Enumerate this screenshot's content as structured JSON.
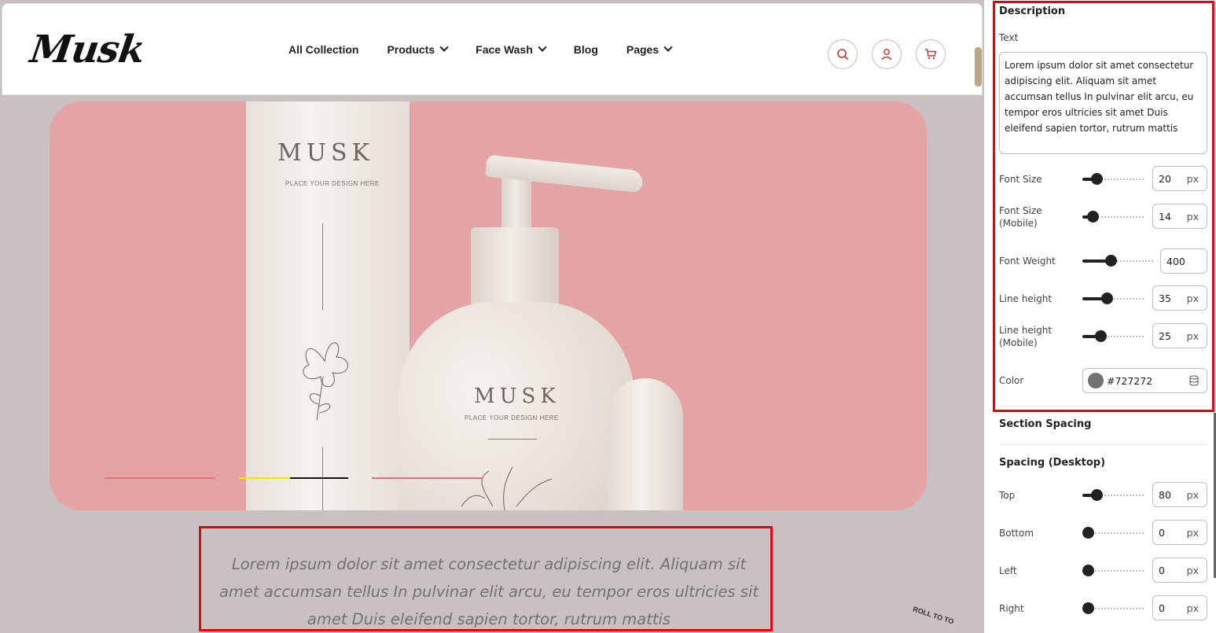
{
  "site": {
    "logo": "Musk",
    "nav": [
      {
        "label": "All Collection",
        "has_dropdown": false
      },
      {
        "label": "Products",
        "has_dropdown": true
      },
      {
        "label": "Face Wash",
        "has_dropdown": true
      },
      {
        "label": "Blog",
        "has_dropdown": false
      },
      {
        "label": "Pages",
        "has_dropdown": true
      }
    ],
    "header_icons": [
      "search-icon",
      "user-icon",
      "cart-icon"
    ]
  },
  "hero": {
    "tube_brand": "MUSK",
    "tube_tagline": "PLACE YOUR DESIGN HERE",
    "bottle_brand": "MUSK",
    "bottle_tagline": "PLACE YOUR DESIGN HERE",
    "slider_indicators": 3,
    "active_slide": 2,
    "background_color": "#e4a4a5"
  },
  "description": {
    "text": "Lorem ipsum dolor sit amet consectetur adipiscing elit. Aliquam sit amet accumsan tellus In pulvinar elit arcu, eu tempor eros ultricies sit amet Duis eleifend sapien tortor, rutrum mattis"
  },
  "scroll_top_label": "ROLL TO TO",
  "panel": {
    "section_title": "Description",
    "text_label": "Text",
    "text_value": "Lorem ipsum dolor sit amet consectetur adipiscing elit. Aliquam sit amet accumsan tellus In pulvinar elit arcu, eu tempor eros ultricies sit amet Duis eleifend sapien tortor, rutrum mattis",
    "font_size": {
      "label": "Font Size",
      "value": "20",
      "unit": "px"
    },
    "font_size_mobile": {
      "label": "Font Size (Mobile)",
      "value": "14",
      "unit": "px"
    },
    "font_weight": {
      "label": "Font Weight",
      "value": "400"
    },
    "line_height": {
      "label": "Line height",
      "value": "35",
      "unit": "px"
    },
    "line_height_mobile": {
      "label": "Line height (Mobile)",
      "value": "25",
      "unit": "px"
    },
    "color": {
      "label": "Color",
      "value": "#727272"
    },
    "section_spacing_title": "Section Spacing",
    "spacing_desktop_title": "Spacing (Desktop)",
    "spacing": {
      "top": {
        "label": "Top",
        "value": "80",
        "unit": "px"
      },
      "bottom": {
        "label": "Bottom",
        "value": "0",
        "unit": "px"
      },
      "left": {
        "label": "Left",
        "value": "0",
        "unit": "px"
      },
      "right": {
        "label": "Right",
        "value": "0",
        "unit": "px"
      }
    },
    "accent_color": "#e8000b"
  }
}
